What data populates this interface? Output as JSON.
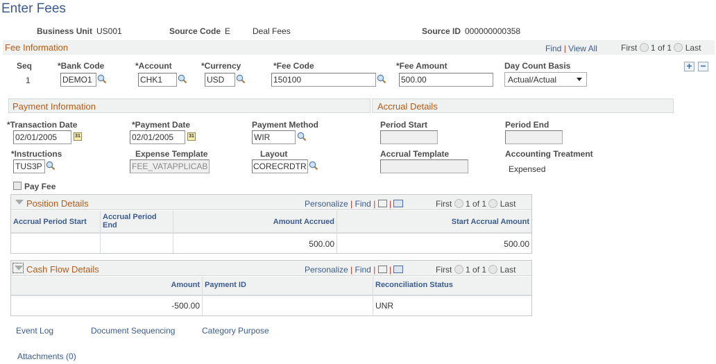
{
  "page": {
    "title": "Enter Fees"
  },
  "header": {
    "business_unit_label": "Business Unit",
    "business_unit_value": "US001",
    "source_code_label": "Source Code",
    "source_code_value": "E",
    "source_code_desc": "Deal Fees",
    "source_id_label": "Source ID",
    "source_id_value": "000000000358"
  },
  "fee_info": {
    "title": "Fee Information",
    "find": "Find",
    "view_all": "View All",
    "first": "First",
    "count": "1 of 1",
    "last": "Last",
    "seq_label": "Seq",
    "seq_value": "1",
    "bank_code_label": "*Bank Code",
    "bank_code_value": "DEMO1",
    "account_label": "*Account",
    "account_value": "CHK1",
    "currency_label": "*Currency",
    "currency_value": "USD",
    "fee_code_label": "*Fee Code",
    "fee_code_value": "150100",
    "fee_amount_label": "*Fee Amount",
    "fee_amount_value": "500.00",
    "day_count_label": "Day Count Basis",
    "day_count_value": "Actual/Actual"
  },
  "payment_info": {
    "title": "Payment Information",
    "transaction_date_label": "*Transaction Date",
    "transaction_date_value": "02/01/2005",
    "payment_date_label": "*Payment Date",
    "payment_date_value": "02/01/2005",
    "payment_method_label": "Payment Method",
    "payment_method_value": "WIR",
    "instructions_label": "*Instructions",
    "instructions_value": "TUS3P",
    "expense_template_label": "Expense Template",
    "expense_template_value": "FEE_VATAPPLICAB",
    "layout_label": "Layout",
    "layout_value": "CORECRDTR",
    "pay_fee_label": "Pay Fee"
  },
  "accrual": {
    "title": "Accrual Details",
    "period_start_label": "Period Start",
    "period_start_value": "",
    "period_end_label": "Period End",
    "period_end_value": "",
    "accrual_template_label": "Accrual Template",
    "accrual_template_value": "",
    "accounting_treatment_label": "Accounting Treatment",
    "accounting_treatment_value": "Expensed"
  },
  "position_details": {
    "title": "Position Details",
    "personalize": "Personalize",
    "find": "Find",
    "first": "First",
    "count": "1 of 1",
    "last": "Last",
    "columns": [
      "Accrual Period Start",
      "Accrual Period End",
      "Amount Accrued",
      "Start Accrual Amount"
    ],
    "rows": [
      [
        "",
        "",
        "500.00",
        "500.00"
      ]
    ]
  },
  "cash_flow": {
    "title": "Cash Flow Details",
    "personalize": "Personalize",
    "find": "Find",
    "first": "First",
    "count": "1 of 1",
    "last": "Last",
    "columns": [
      "Amount",
      "Payment ID",
      "Reconciliation Status"
    ],
    "rows": [
      [
        "-500.00",
        "",
        "UNR"
      ]
    ]
  },
  "footer_links": {
    "event_log": "Event Log",
    "document_sequencing": "Document Sequencing",
    "category_purpose": "Category Purpose",
    "attachments": "Attachments (0)"
  }
}
